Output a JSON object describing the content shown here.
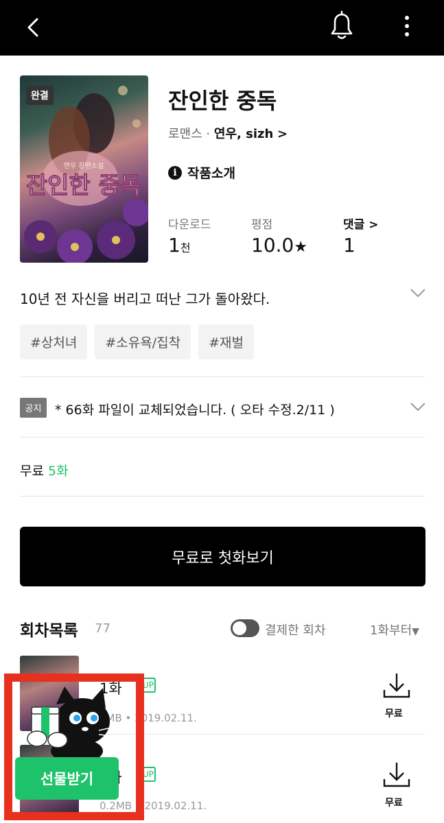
{
  "work": {
    "status_badge": "완결",
    "title": "잔인한 중독",
    "genre": "로맨스",
    "separator": "·",
    "author": "연우, sizh",
    "author_arrow": ">",
    "intro_label": "작품소개",
    "info_icon_glyph": "i",
    "cover_title": "잔인한 중독",
    "cover_subtitle": "연우 장편소설"
  },
  "stats": {
    "downloads_label": "다운로드",
    "downloads_value": "1",
    "downloads_unit": "천",
    "rating_label": "평점",
    "rating_value": "10.0",
    "rating_star": "★",
    "comments_label": "댓글",
    "comments_arrow": ">",
    "comments_value": "1"
  },
  "synopsis": "10년 전 자신을 버리고 떠난 그가 돌아왔다.",
  "tags": [
    "#상처녀",
    "#소유욕/집착",
    "#재벌"
  ],
  "notice": {
    "badge": "공지",
    "text": "* 66화 파일이 교체되었습니다. ( 오타 수정.2/11 )"
  },
  "free": {
    "label": "무료",
    "count": "5화"
  },
  "cta_label": "무료로 첫화보기",
  "episode_list": {
    "title": "회차목록",
    "count": "77",
    "toggle_label": "결제한 회차",
    "sort_label": "1화부터",
    "sort_arrow": "▼"
  },
  "episodes": [
    {
      "title": "1화",
      "up_badge": "UP",
      "meta": "2MB • 2019.02.11.",
      "price": "무료"
    },
    {
      "title": "2화",
      "up_badge": "UP",
      "meta": "0.2MB • 2019.02.11.",
      "price": "무료"
    }
  ],
  "gift": {
    "button_label": "선물받기"
  },
  "colors": {
    "accent_green": "#1ec26b",
    "highlight_red": "#e8301e",
    "topbar": "#000000"
  },
  "icons": {
    "back": "chevron-left-icon",
    "bell": "bell-icon",
    "more": "more-vertical-icon",
    "download": "download-icon",
    "expand": "chevron-down-icon"
  }
}
